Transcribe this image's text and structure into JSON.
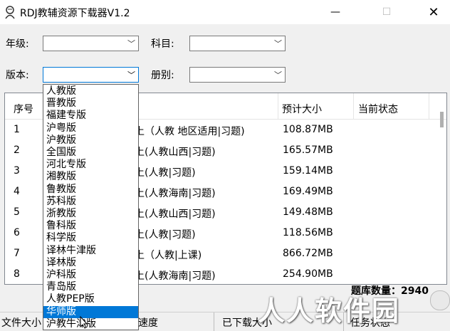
{
  "window": {
    "title": "RDJ教辅资源下载器V1.2",
    "min_glyph": "—",
    "max_glyph": "☐",
    "close_glyph": "✕"
  },
  "filters": {
    "grade_label": "年级:",
    "subject_label": "科目:",
    "edition_label": "版本:",
    "volume_label": "册别:",
    "grade_value": "",
    "subject_value": "",
    "edition_value": "",
    "volume_value": ""
  },
  "edition_dropdown": {
    "options": [
      "人教版",
      "晋教版",
      "福建专版",
      "沪粤版",
      "沪教版",
      "全国版",
      "河北专版",
      "湘教版",
      "鲁教版",
      "苏科版",
      "浙教版",
      "鲁科版",
      "科学版",
      "译林牛津版",
      "译林版",
      "沪科版",
      "青岛版",
      "人教PEP版",
      "华师版",
      "沪教牛津版"
    ],
    "selected_index": 18
  },
  "table": {
    "columns": [
      "序号",
      "",
      "预计大小",
      "当前状态"
    ],
    "rows": [
      {
        "no": "1",
        "name": "上（人教 地区适用|习题)",
        "size": "108.87MB",
        "status": ""
      },
      {
        "no": "2",
        "name": "上(人教山西|习题)",
        "size": "165.57MB",
        "status": ""
      },
      {
        "no": "3",
        "name": "上(人教|习题)",
        "size": "159.14MB",
        "status": ""
      },
      {
        "no": "4",
        "name": "上(人教海南|习题)",
        "size": "169.49MB",
        "status": ""
      },
      {
        "no": "5",
        "name": "上(人教山西|习题)",
        "size": "149.48MB",
        "status": ""
      },
      {
        "no": "6",
        "name": "上(人教|习题)",
        "size": "118.56MB",
        "status": ""
      },
      {
        "no": "7",
        "name": "上（人教|上课)",
        "size": "866.72MB",
        "status": ""
      },
      {
        "no": "8",
        "name": "上(人教海南|习题)",
        "size": "254.90MB",
        "status": ""
      }
    ]
  },
  "record_count": "题库数量：2940",
  "status_bar": {
    "file_size_label": "文件大小",
    "speed_label": "速度",
    "downloaded_label": "已下载大小",
    "task_status_label": "任务状态"
  },
  "watermark": "人人软件园"
}
